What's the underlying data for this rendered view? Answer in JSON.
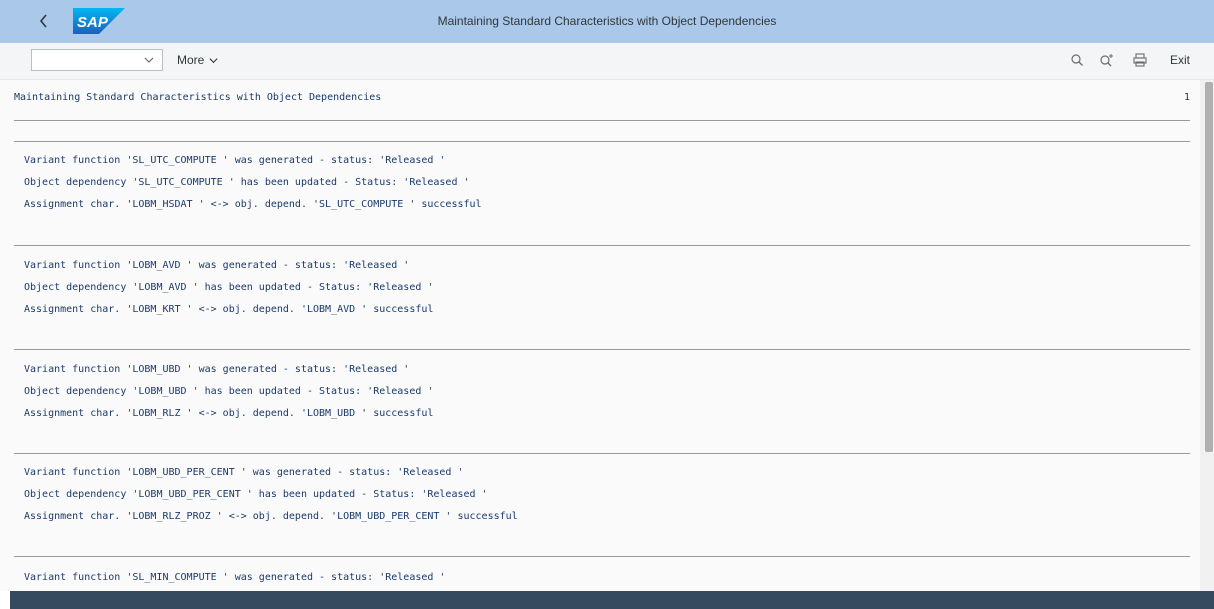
{
  "header": {
    "title": "Maintaining Standard Characteristics with Object Dependencies",
    "logo_text": "SAP",
    "back_icon": "chevron-left-icon"
  },
  "toolbar": {
    "select_value": "",
    "more_label": "More",
    "icons": [
      "search-icon",
      "search-next-icon",
      "print-icon"
    ],
    "exit_label": "Exit"
  },
  "report": {
    "heading": "Maintaining Standard Characteristics with Object Dependencies",
    "page_number": "1",
    "blocks": [
      {
        "lines": [
          "Variant function 'SL_UTC_COMPUTE ' was generated - status: 'Released '",
          "Object dependency 'SL_UTC_COMPUTE ' has been updated - Status: 'Released '",
          "Assignment char. 'LOBM_HSDAT ' <-> obj. depend. 'SL_UTC_COMPUTE ' successful"
        ]
      },
      {
        "lines": [
          "Variant function 'LOBM_AVD ' was generated - status: 'Released '",
          "Object dependency 'LOBM_AVD ' has been updated - Status: 'Released '",
          "Assignment char. 'LOBM_KRT ' <-> obj. depend. 'LOBM_AVD ' successful"
        ]
      },
      {
        "lines": [
          "Variant function 'LOBM_UBD ' was generated - status: 'Released '",
          "Object dependency 'LOBM_UBD ' has been updated - Status: 'Released '",
          "Assignment char. 'LOBM_RLZ ' <-> obj. depend. 'LOBM_UBD ' successful"
        ]
      },
      {
        "lines": [
          "Variant function 'LOBM_UBD_PER_CENT ' was generated - status: 'Released '",
          "Object dependency 'LOBM_UBD_PER_CENT ' has been updated - Status: 'Released '",
          "Assignment char. 'LOBM_RLZ_PROZ ' <-> obj. depend. 'LOBM_UBD_PER_CENT ' successful"
        ]
      },
      {
        "lines": [
          "Variant function 'SL_MIN_COMPUTE ' was generated - status: 'Released '"
        ]
      }
    ]
  },
  "colors": {
    "titlebar": "#a9c8ea",
    "toolbar": "#f3f5f7",
    "text": "#1a3a6c",
    "footer": "#354a5f"
  }
}
